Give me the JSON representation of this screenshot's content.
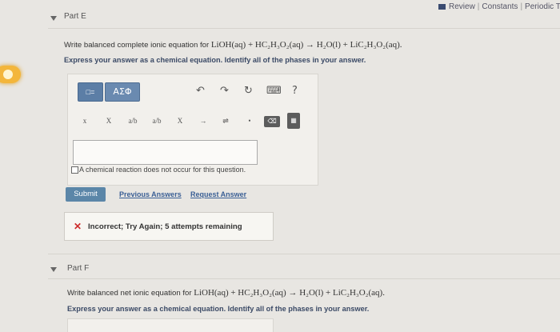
{
  "top_links": {
    "review": "Review",
    "constants": "Constants",
    "periodic": "Periodic Ta"
  },
  "part_e": {
    "title": "Part E",
    "question_prefix": "Write balanced complete ionic equation for",
    "equation": "LiOH(aq) + HC₂H₃O₂(aq) → H₂O(l) + LiC₂H₃O₂(aq).",
    "instruction": "Express your answer as a chemical equation. Identify all of the phases in your answer.",
    "toolbar": {
      "template_label": "□=",
      "greek_label": "ΑΣΦ",
      "undo": "↶",
      "redo": "↷",
      "reset": "↻",
      "keyboard": "⌨",
      "help": "?",
      "superscript": "x",
      "subscript": "X",
      "frac1": "a/b",
      "frac2": "a/b",
      "strike": "X",
      "arrow": "→",
      "equilibrium": "⇌",
      "dot": "•",
      "delete": "⌫",
      "calc": "▦"
    },
    "answer_value": "",
    "no_reaction_label": "A chemical reaction does not occur for this question.",
    "submit_label": "Submit",
    "previous_answers": "Previous Answers",
    "request_answer": "Request Answer",
    "feedback": "Incorrect; Try Again; 5 attempts remaining",
    "feedback_color": "#cc2a2a"
  },
  "part_f": {
    "title": "Part F",
    "question_prefix": "Write balanced net ionic equation for",
    "equation": "LiOH(aq) + HC₂H₃O₂(aq) → H₂O(l) + LiC₂H₃O₂(aq).",
    "instruction": "Express your answer as a chemical equation. Identify all of the phases in your answer."
  }
}
